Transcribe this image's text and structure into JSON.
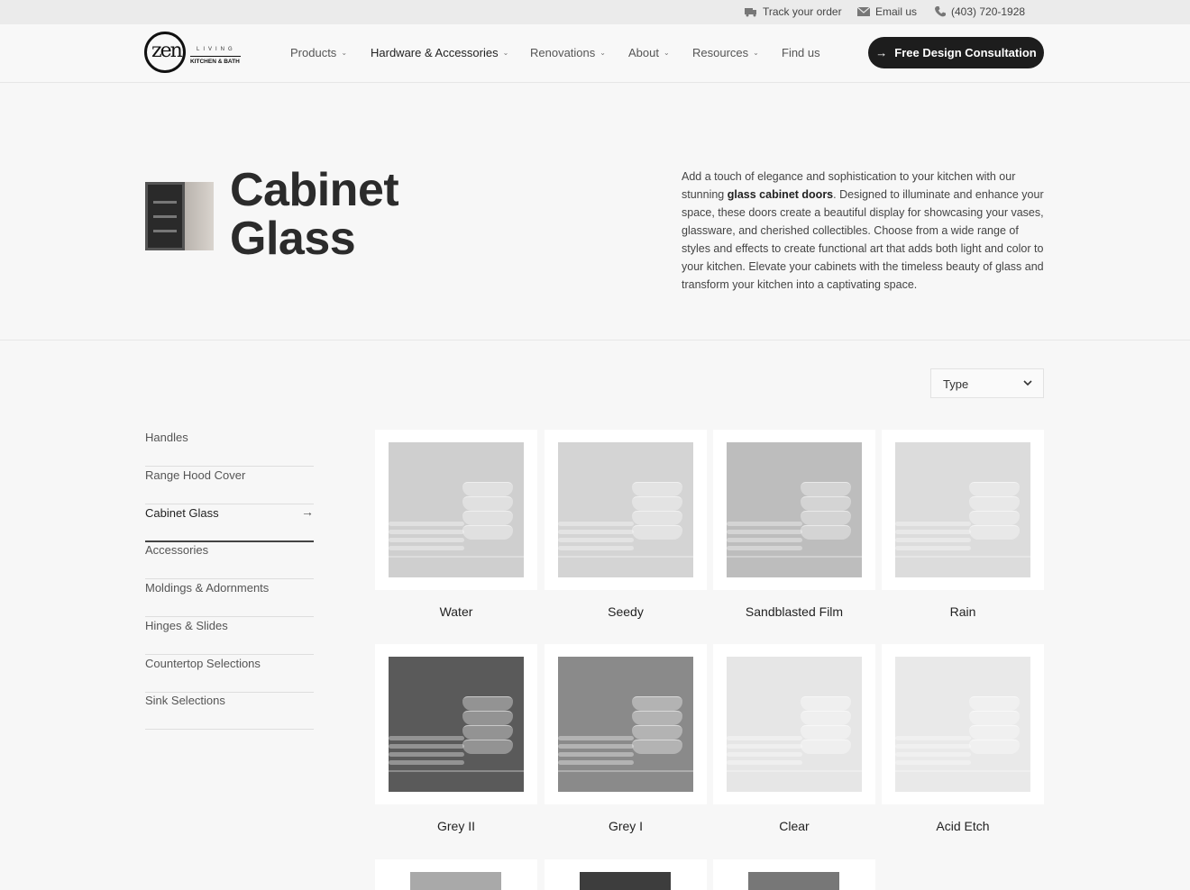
{
  "topbar": {
    "track_order": "Track your order",
    "email": "Email us",
    "phone": "(403) 720-1928"
  },
  "logo": {
    "mark": "zen",
    "living": "LIVING",
    "tagline": "KITCHEN & BATH"
  },
  "nav": {
    "items": [
      "Products",
      "Hardware & Accessories",
      "Renovations",
      "About",
      "Resources",
      "Find us"
    ],
    "active": "Hardware & Accessories",
    "cta": "Free Design Consultation"
  },
  "hero": {
    "title_line1": "Cabinet",
    "title_line2": "Glass",
    "desc_part1": "Add a touch of elegance and sophistication to your kitchen with our stunning ",
    "desc_bold": "glass cabinet doors",
    "desc_part2": ". Designed to illuminate and enhance your space, these doors create a beautiful display for showcasing your vases, glassware, and cherished collectibles. Choose from a wide range of styles and effects to create functional art that adds both light and color to your kitchen. Elevate your cabinets with the timeless beauty of glass and transform your kitchen into a captivating space."
  },
  "filter": {
    "type_label": "Type"
  },
  "sidebar": {
    "items": [
      "Handles",
      "Range Hood Cover",
      "Cabinet Glass",
      "Accessories",
      "Moldings & Adornments",
      "Hinges & Slides",
      "Countertop Selections",
      "Sink Selections"
    ],
    "active": "Cabinet Glass"
  },
  "products": [
    {
      "name": "Water",
      "tone": "#cfcfcf"
    },
    {
      "name": "Seedy",
      "tone": "#d4d4d4"
    },
    {
      "name": "Sandblasted Film",
      "tone": "#bdbdbd"
    },
    {
      "name": "Rain",
      "tone": "#dcdcdc"
    },
    {
      "name": "Grey II",
      "tone": "#5a5a5a"
    },
    {
      "name": "Grey I",
      "tone": "#8a8a8a"
    },
    {
      "name": "Clear",
      "tone": "#e6e6e6"
    },
    {
      "name": "Acid Etch",
      "tone": "#e9e9e9"
    }
  ],
  "partial_tones": [
    "#a9a9a9",
    "#3d3d3d",
    "#777777"
  ]
}
